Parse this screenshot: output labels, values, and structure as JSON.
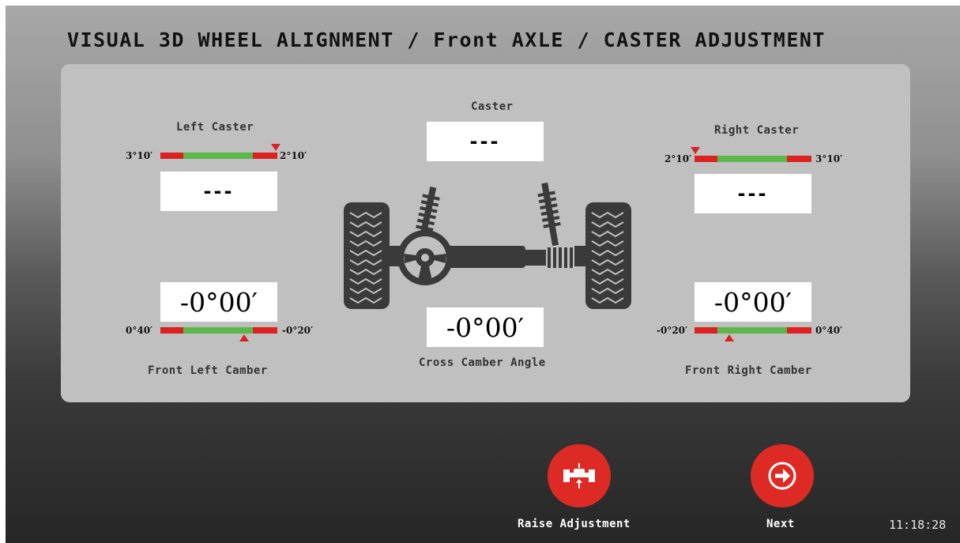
{
  "header": {
    "title": "VISUAL 3D WHEEL ALIGNMENT / Front AXLE / CASTER ADJUSTMENT"
  },
  "left_caster": {
    "label": "Left Caster",
    "value": "---",
    "scale_min": "3°10′",
    "scale_max": "2°10′",
    "indicator_position": 1.0
  },
  "caster": {
    "label": "Caster",
    "value": "---"
  },
  "right_caster": {
    "label": "Right Caster",
    "value": "---",
    "scale_min": "2°10′",
    "scale_max": "3°10′",
    "indicator_position": 0.0
  },
  "front_left_camber": {
    "label": "Front Left Camber",
    "value": "-0°00′",
    "scale_min": "0°40′",
    "scale_max": "-0°20′",
    "indicator_position": 0.67
  },
  "cross_camber": {
    "label": "Cross Camber Angle",
    "value": "-0°00′"
  },
  "front_right_camber": {
    "label": "Front Right Camber",
    "value": "-0°00′",
    "scale_min": "-0°20′",
    "scale_max": "0°40′",
    "indicator_position": 0.33
  },
  "buttons": {
    "raise_label": "Raise Adjustment",
    "next_label": "Next"
  },
  "status": {
    "clock": "11:18:28"
  },
  "icons": {
    "axle": "axle-steering-icon",
    "raise": "lift-icon",
    "next": "arrow-right-circle-icon"
  },
  "colors": {
    "accent": "#dd2a24",
    "in_tolerance": "#5cb84a",
    "out_tolerance": "#dd2020"
  }
}
